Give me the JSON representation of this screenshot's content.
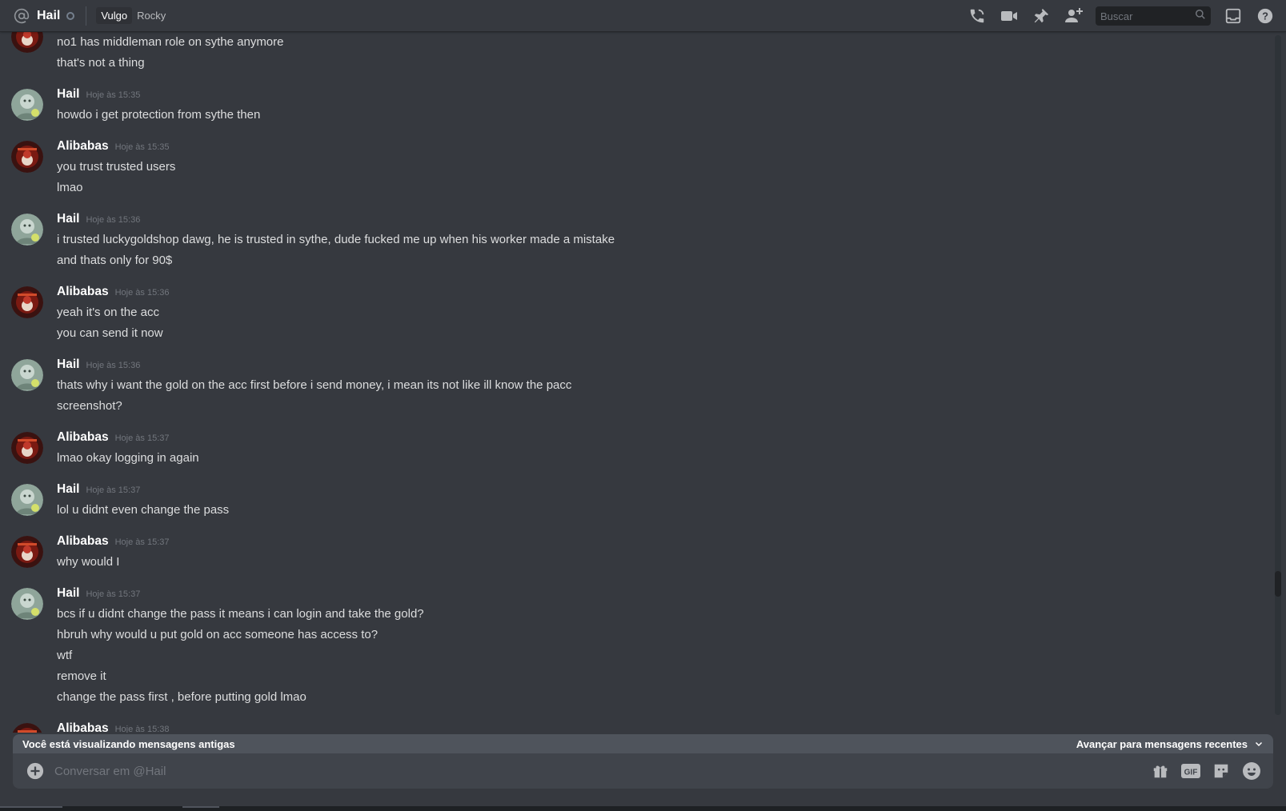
{
  "header": {
    "title": "Hail",
    "tags": [
      "Vulgo",
      "Rocky"
    ],
    "search_placeholder": "Buscar",
    "icons": [
      "call-icon",
      "video-icon",
      "pin-icon",
      "add-friend-icon",
      "inbox-icon",
      "help-icon"
    ]
  },
  "colors": {
    "background": "#36393f",
    "header_bg": "#36393f",
    "composer_bg": "#40444b",
    "banner_bg": "#4f545c",
    "timestamp": "#72767d",
    "text": "#dcddde"
  },
  "messages": {
    "continued": {
      "lines": [
        "no1 has middleman role on sythe anymore",
        "that's not a thing"
      ]
    },
    "groups": [
      {
        "author": "Hail",
        "avatar": "hail",
        "time": "Hoje às 15:35",
        "lines": [
          "howdo i get protection from sythe then"
        ]
      },
      {
        "author": "Alibabas",
        "avatar": "alibabas",
        "time": "Hoje às 15:35",
        "lines": [
          "you trust trusted users",
          "lmao"
        ]
      },
      {
        "author": "Hail",
        "avatar": "hail",
        "time": "Hoje às 15:36",
        "lines": [
          "i trusted luckygoldshop dawg, he is trusted in sythe, dude fucked me up when his worker made a mistake",
          "and thats only for 90$"
        ]
      },
      {
        "author": "Alibabas",
        "avatar": "alibabas",
        "time": "Hoje às 15:36",
        "lines": [
          "yeah it's on the acc",
          "you can send it now"
        ]
      },
      {
        "author": "Hail",
        "avatar": "hail",
        "time": "Hoje às 15:36",
        "lines": [
          "thats why i want the gold on the acc first before i send money, i mean its not like ill know the pacc",
          "screenshot?"
        ]
      },
      {
        "author": "Alibabas",
        "avatar": "alibabas",
        "time": "Hoje às 15:37",
        "lines": [
          "lmao okay logging in again"
        ]
      },
      {
        "author": "Hail",
        "avatar": "hail",
        "time": "Hoje às 15:37",
        "lines": [
          "lol u didnt even change the pass"
        ]
      },
      {
        "author": "Alibabas",
        "avatar": "alibabas",
        "time": "Hoje às 15:37",
        "lines": [
          "why would I"
        ]
      },
      {
        "author": "Hail",
        "avatar": "hail",
        "time": "Hoje às 15:37",
        "lines": [
          "bcs if u didnt change the pass it means i can login and take the gold?",
          "hbruh why would u put gold on acc someone has access to?",
          "wtf",
          "remove it",
          "change the pass first , before putting gold lmao"
        ]
      },
      {
        "author": "Alibabas",
        "avatar": "alibabas",
        "time": "Hoje às 15:38",
        "lines": []
      }
    ]
  },
  "banner": {
    "old_messages_text": "Você está visualizando mensagens antigas",
    "jump_text": "Avançar para mensagens recentes"
  },
  "composer": {
    "placeholder": "Conversar em @Hail",
    "icons": [
      "gift-icon",
      "gif-icon",
      "sticker-icon",
      "emoji-icon"
    ]
  }
}
